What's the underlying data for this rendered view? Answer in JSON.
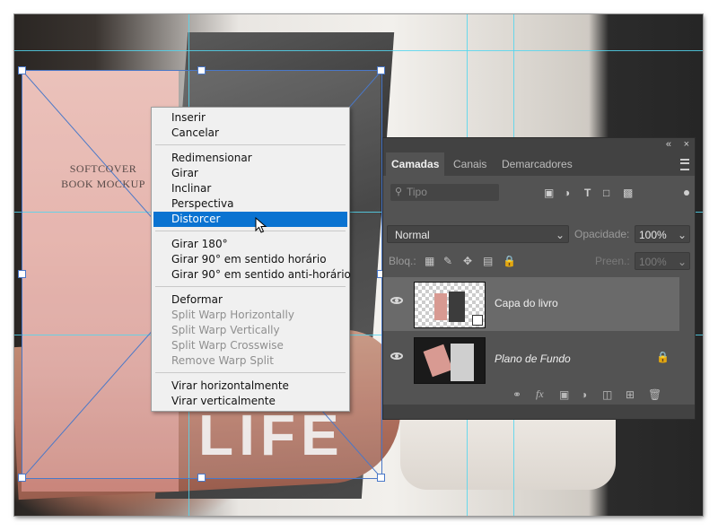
{
  "canvas": {
    "book_cover_lines": [
      "SOFTCOVER",
      "BOOK MOCKUP"
    ],
    "shirt_text": "LIFE"
  },
  "context_menu": {
    "items": [
      {
        "label": "Inserir",
        "enabled": true
      },
      {
        "label": "Cancelar",
        "enabled": true
      },
      {
        "label": "Redimensionar",
        "enabled": true
      },
      {
        "label": "Girar",
        "enabled": true
      },
      {
        "label": "Inclinar",
        "enabled": true
      },
      {
        "label": "Perspectiva",
        "enabled": true
      },
      {
        "label": "Distorcer",
        "enabled": true,
        "highlighted": true
      },
      {
        "label": "Girar 180°",
        "enabled": true
      },
      {
        "label": "Girar 90° em sentido horário",
        "enabled": true
      },
      {
        "label": "Girar 90° em sentido anti-horário",
        "enabled": true
      },
      {
        "label": "Deformar",
        "enabled": true
      },
      {
        "label": "Split Warp Horizontally",
        "enabled": false
      },
      {
        "label": "Split Warp Vertically",
        "enabled": false
      },
      {
        "label": "Split Warp Crosswise",
        "enabled": false
      },
      {
        "label": "Remove Warp Split",
        "enabled": false
      },
      {
        "label": "Virar horizontalmente",
        "enabled": true
      },
      {
        "label": "Virar verticalmente",
        "enabled": true
      }
    ]
  },
  "layers_panel": {
    "collapse_icon": "«",
    "close_icon": "×",
    "tabs": [
      "Camadas",
      "Canais",
      "Demarcadores"
    ],
    "active_tab": "Camadas",
    "filter_placeholder": "Tipo",
    "blend_mode": "Normal",
    "opacity_label": "Opacidade:",
    "opacity_value": "100%",
    "lock_label": "Bloq.:",
    "fill_label": "Preen.:",
    "fill_value": "100%",
    "layers": [
      {
        "name": "Capa do livro",
        "selected": true,
        "visible": true,
        "smart_object": true
      },
      {
        "name": "Plano de Fundo",
        "selected": false,
        "visible": true,
        "locked": true
      }
    ],
    "colors": {
      "panel_bg": "#535353",
      "selected_layer": "#6a6a6a",
      "menu_highlight": "#0a73d1",
      "guide": "#54d6ee"
    }
  }
}
